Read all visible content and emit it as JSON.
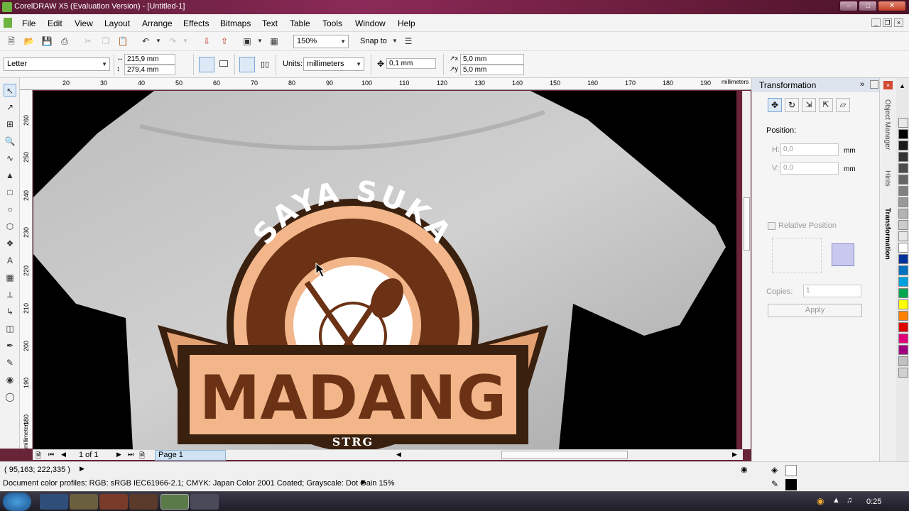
{
  "window": {
    "title": "CorelDRAW X5 (Evaluation Version) - [Untitled-1]"
  },
  "menu": [
    "File",
    "Edit",
    "View",
    "Layout",
    "Arrange",
    "Effects",
    "Bitmaps",
    "Text",
    "Table",
    "Tools",
    "Window",
    "Help"
  ],
  "toolbar": {
    "zoom": "150%",
    "snap_to": "Snap to"
  },
  "propbar": {
    "page_size": "Letter",
    "width": "215,9 mm",
    "height": "279,4 mm",
    "units_label": "Units:",
    "units": "millimeters",
    "nudge": "0,1 mm",
    "dup_x": "5,0 mm",
    "dup_y": "5,0 mm"
  },
  "ruler": {
    "h": [
      "20",
      "30",
      "40",
      "50",
      "60",
      "70",
      "80",
      "90",
      "100",
      "110",
      "120",
      "130",
      "140",
      "150",
      "160",
      "170",
      "180",
      "190"
    ],
    "h_unit": "millimeters",
    "v": [
      "260",
      "250",
      "240",
      "230",
      "220",
      "210",
      "200",
      "190",
      "180"
    ],
    "v_unit": "millimeters"
  },
  "artwork": {
    "arc_text": "SAYA SUKA",
    "main_text": "MADANG",
    "sub_text": "STRG"
  },
  "docker": {
    "title": "Transformation",
    "position_label": "Position:",
    "h_label": "H:",
    "h_value": "0,0",
    "v_label": "V:",
    "v_value": "0,0",
    "unit": "mm",
    "relative": "Relative Position",
    "copies_label": "Copies:",
    "copies_value": "1",
    "apply": "Apply",
    "tabs": [
      "Object Manager",
      "Hints",
      "Transformation"
    ]
  },
  "pagenav": {
    "counter": "1 of 1",
    "page_tab": "Page 1"
  },
  "status": {
    "coords": "( 95,163; 222,335 )",
    "profiles": "Document color profiles: RGB: sRGB IEC61966-2.1; CMYK: Japan Color 2001 Coated; Grayscale: Dot Gain 15%"
  },
  "taskbar": {
    "clock": "0:25"
  },
  "palette": [
    "#ffffff",
    "#000000",
    "#1a1a1a",
    "#333333",
    "#4d4d4d",
    "#666666",
    "#808080",
    "#999999",
    "#b3b3b3",
    "#cccccc",
    "#e6e6e6",
    "#ffffff",
    "#00309a",
    "#0070c0",
    "#00a0e0",
    "#00a650",
    "#ffff00",
    "#ff8000",
    "#e00000",
    "#e0007a",
    "#a00080",
    "#c0c0c0",
    "#d0d0d0"
  ]
}
